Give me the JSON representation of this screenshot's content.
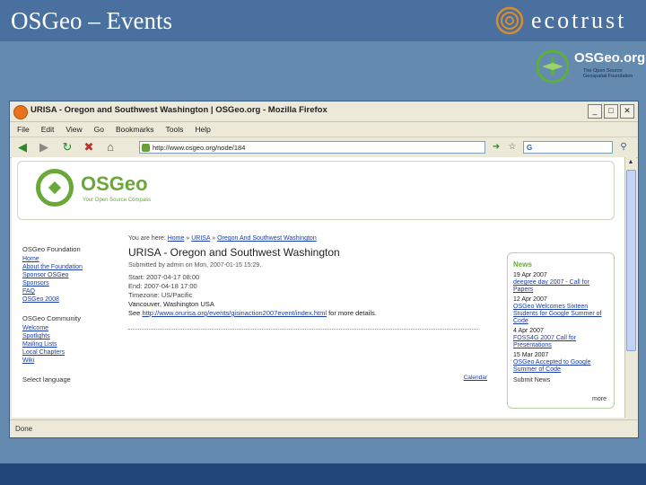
{
  "slide": {
    "title": "OSGeo – Events",
    "brand_ecotrust": "ecotrust",
    "brand_osgeo": "OSGeo.org",
    "brand_osgeo_tag": "The Open Source Geospatial Foundation"
  },
  "browser": {
    "window_title": "URISA - Oregon and Southwest Washington | OSGeo.org - Mozilla Firefox",
    "menu": [
      "File",
      "Edit",
      "View",
      "Go",
      "Bookmarks",
      "Tools",
      "Help"
    ],
    "url": "http://www.osgeo.org/node/184",
    "search_value": "G",
    "status": "Done"
  },
  "site": {
    "logo_text": "OSGeo",
    "tagline": "Your Open Source Compass"
  },
  "left_nav": {
    "foundation_heading": "OSGeo Foundation",
    "foundation_links": [
      "Home",
      "About the Foundation",
      "Sponsor OSGeo",
      "Sponsors",
      "FAQ",
      "OSGeo 2008"
    ],
    "community_heading": "OSGeo Community",
    "community_links": [
      "Welcome",
      "Spotlights",
      "Mailing Lists",
      "Local Chapters",
      "Wiki"
    ],
    "language_heading": "Select language"
  },
  "event": {
    "crumb_prefix": "You are here:",
    "crumb_home": "Home",
    "crumb_sep1": "»",
    "crumb_urisa": "URISA",
    "crumb_sep2": "»",
    "crumb_current": "Oregon And Southwest Washington",
    "title": "URISA - Oregon and Southwest Washington",
    "submitted": "Submitted by admin on Mon, 2007-01-15 15:29.",
    "start": "Start: 2007-04-17 08:00",
    "end": "End: 2007-04-18 17:00",
    "timezone": "Timezone: US/Pacific",
    "location": "Vancouver, Washington USA",
    "see_prefix": "See",
    "see_link": "http://www.orurisa.org/events/gisinaction2007event/index.html",
    "see_suffix": "for more details.",
    "calendar_link": "Calendar"
  },
  "news": {
    "heading": "News",
    "items": [
      {
        "date": "19 Apr 2007",
        "title": "deegree day 2007 - Call for Papers"
      },
      {
        "date": "12 Apr 2007",
        "title": "OSGeo Welcomes Sixteen Students for Google Summer of Code"
      },
      {
        "date": "4 Apr 2007",
        "title": "FOSS4G 2007 Call for Presentations"
      },
      {
        "date": "15 Mar 2007",
        "title": "OSGeo Accepted to Google Summer of Code"
      }
    ],
    "submit": "Submit News",
    "more": "more"
  }
}
